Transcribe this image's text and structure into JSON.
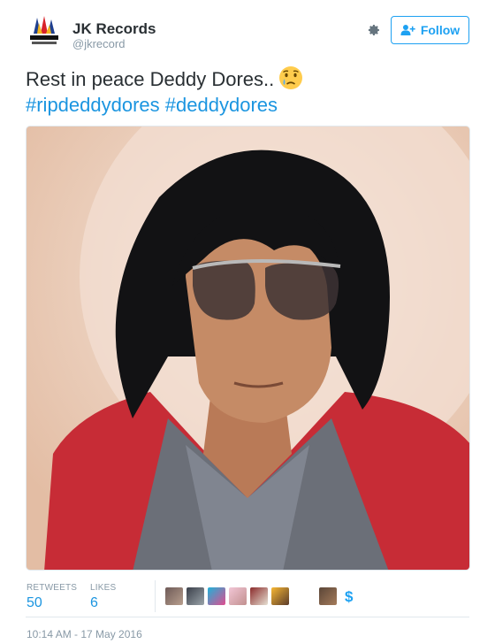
{
  "user": {
    "display_name": "JK Records",
    "handle": "@jkrecord",
    "logo_text": "RECORDS"
  },
  "header": {
    "follow_label": "Follow"
  },
  "tweet": {
    "text": "Rest in peace Deddy Dores..",
    "emoji": "crying-face",
    "hashtags": [
      "#ripdeddydores",
      "#deddydores"
    ]
  },
  "stats": {
    "retweets_label": "RETWEETS",
    "retweets_count": "50",
    "likes_label": "LIKES",
    "likes_count": "6"
  },
  "timestamp": "10:14 AM - 17 May 2016",
  "colors": {
    "accent": "#1da1f2",
    "link": "#1b95e0",
    "muted": "#8899a6",
    "border": "#e1e8ed"
  }
}
